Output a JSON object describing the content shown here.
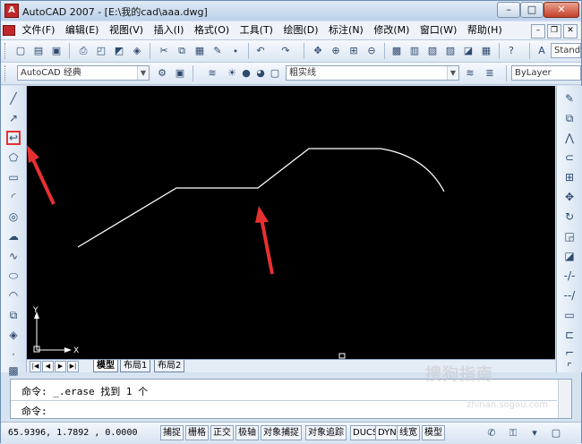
{
  "window": {
    "title": "AutoCAD 2007 - [E:\\我的cad\\aaa.dwg]",
    "controls": {
      "minimize": "–",
      "maximize": "□",
      "close": "✕"
    }
  },
  "menubar": {
    "items": [
      {
        "label": "文件(F)"
      },
      {
        "label": "编辑(E)"
      },
      {
        "label": "视图(V)"
      },
      {
        "label": "插入(I)"
      },
      {
        "label": "格式(O)"
      },
      {
        "label": "工具(T)"
      },
      {
        "label": "绘图(D)"
      },
      {
        "label": "标注(N)"
      },
      {
        "label": "修改(M)"
      },
      {
        "label": "窗口(W)"
      },
      {
        "label": "帮助(H)"
      }
    ]
  },
  "toolbar2": {
    "workspace": "AutoCAD 经典",
    "linetype": "粗实线",
    "lineweight": "ByLayer",
    "textstyle": "Stand"
  },
  "drawing": {
    "ucs_y": "Y",
    "ucs_x": "X"
  },
  "tabs": {
    "items": [
      {
        "label": "模型",
        "active": true
      },
      {
        "label": "布局1",
        "active": false
      },
      {
        "label": "布局2",
        "active": false
      }
    ]
  },
  "command": {
    "line1": "命令: _.erase 找到 1 个",
    "line2": "命令:"
  },
  "status": {
    "coords": "65.9396, 1.7892 , 0.0000",
    "buttons": [
      "捕捉",
      "栅格",
      "正交",
      "极轴",
      "对象捕捉",
      "对象追踪",
      "DUCS",
      "DYN",
      "线宽",
      "模型"
    ]
  },
  "watermark": {
    "main": "搜狗指南",
    "sub": "zhinan.sogou.com"
  },
  "colors": {
    "canvas": "#000000",
    "annotation_arrow": "#e83030",
    "polyline": "#ffffff"
  }
}
